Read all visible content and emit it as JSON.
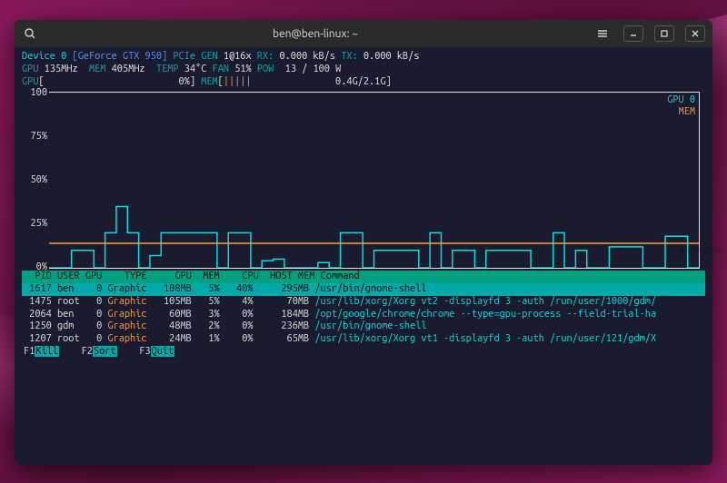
{
  "window": {
    "title": "ben@ben-linux: ~"
  },
  "device": {
    "label": "Device 0",
    "model": "GeForce GTX 950",
    "pcie_label": "PCIe GEN",
    "pcie_value": "1@16x",
    "rx_label": "RX:",
    "rx_value": "0.000 kB/s",
    "tx_label": "TX:",
    "tx_value": "0.000 kB/s"
  },
  "stats": {
    "gpu_label": "GPU",
    "gpu_clock": "135MHz",
    "mem_label": "MEM",
    "mem_clock": "405MHz",
    "temp_label": "TEMP",
    "temp_value": "34°C",
    "fan_label": "FAN",
    "fan_value": "51%",
    "pow_label": "POW",
    "pow_value": "13 / 100 W"
  },
  "bars": {
    "gpu_label": "GPU",
    "gpu_pct": "0%",
    "mem_label": "MEM",
    "mem_value": "0.4G/2.1G"
  },
  "chart_data": {
    "type": "line",
    "xlabel": "",
    "ylabel": "%",
    "ylim": [
      0,
      100
    ],
    "y_ticks": [
      "100",
      "75%",
      "50%",
      "25%",
      "0%"
    ],
    "grid": false,
    "legend_position": "top-right",
    "series": [
      {
        "name": "GPU 0",
        "color": "#00e0e0",
        "values": [
          0,
          0,
          10,
          10,
          0,
          20,
          35,
          20,
          0,
          7,
          20,
          20,
          20,
          20,
          20,
          0,
          20,
          20,
          0,
          4,
          5,
          0,
          0,
          0,
          3,
          0,
          20,
          20,
          0,
          10,
          10,
          10,
          10,
          0,
          20,
          0,
          10,
          10,
          0,
          10,
          10,
          10,
          10,
          0,
          0,
          20,
          0,
          10,
          0,
          0,
          12,
          12,
          12,
          0,
          0,
          18,
          18,
          0,
          0
        ]
      },
      {
        "name": "MEM",
        "color": "#ffa040",
        "values": [
          14,
          14,
          14,
          14,
          14,
          14,
          14,
          14,
          14,
          14,
          14,
          14,
          14,
          14,
          14,
          14,
          14,
          14,
          14,
          14,
          14,
          14,
          14,
          14,
          14,
          14,
          14,
          14,
          14,
          14,
          14,
          14,
          14,
          14,
          14,
          14,
          14,
          14,
          14,
          14,
          14,
          14,
          14,
          14,
          14,
          14,
          14,
          14,
          14,
          14,
          14,
          14,
          14,
          14,
          14,
          14,
          14,
          14,
          14
        ]
      }
    ]
  },
  "table": {
    "headers": {
      "pid": "PID",
      "user": "USER",
      "gpu": "GPU",
      "type": "TYPE",
      "gpu_pct": "GPU",
      "mem_pct": "MEM",
      "cpu": "CPU",
      "host_mem": "HOST MEM",
      "command": "Command"
    },
    "rows": [
      {
        "pid": "1617",
        "user": "ben",
        "gpu": "0",
        "type": "Graphic",
        "gpu_mb": "108MB",
        "mem_pct": "5%",
        "cpu": "40%",
        "host_mem": "295MB",
        "cmd": "/usr/bin/gnome-shell",
        "selected": true
      },
      {
        "pid": "1475",
        "user": "root",
        "gpu": "0",
        "type": "Graphic",
        "gpu_mb": "105MB",
        "mem_pct": "5%",
        "cpu": "4%",
        "host_mem": "70MB",
        "cmd": "/usr/lib/xorg/Xorg vt2 -displayfd 3 -auth /run/user/1000/gdm/",
        "selected": false
      },
      {
        "pid": "2064",
        "user": "ben",
        "gpu": "0",
        "type": "Graphic",
        "gpu_mb": "60MB",
        "mem_pct": "3%",
        "cpu": "0%",
        "host_mem": "184MB",
        "cmd": "/opt/google/chrome/chrome --type=gpu-process --field-trial-ha",
        "selected": false
      },
      {
        "pid": "1250",
        "user": "gdm",
        "gpu": "0",
        "type": "Graphic",
        "gpu_mb": "48MB",
        "mem_pct": "2%",
        "cpu": "0%",
        "host_mem": "236MB",
        "cmd": "/usr/bin/gnome-shell",
        "selected": false
      },
      {
        "pid": "1207",
        "user": "root",
        "gpu": "0",
        "type": "Graphic",
        "gpu_mb": "24MB",
        "mem_pct": "1%",
        "cpu": "0%",
        "host_mem": "65MB",
        "cmd": "/usr/lib/xorg/Xorg vt1 -displayfd 3 -auth /run/user/121/gdm/X",
        "selected": false
      }
    ]
  },
  "footer": {
    "f1": "F1",
    "f1_action": "Kill",
    "f2": "F2",
    "f2_action": "Sort",
    "f3": "F3",
    "f3_action": "Quit"
  },
  "watermark": "wsxdn.com"
}
